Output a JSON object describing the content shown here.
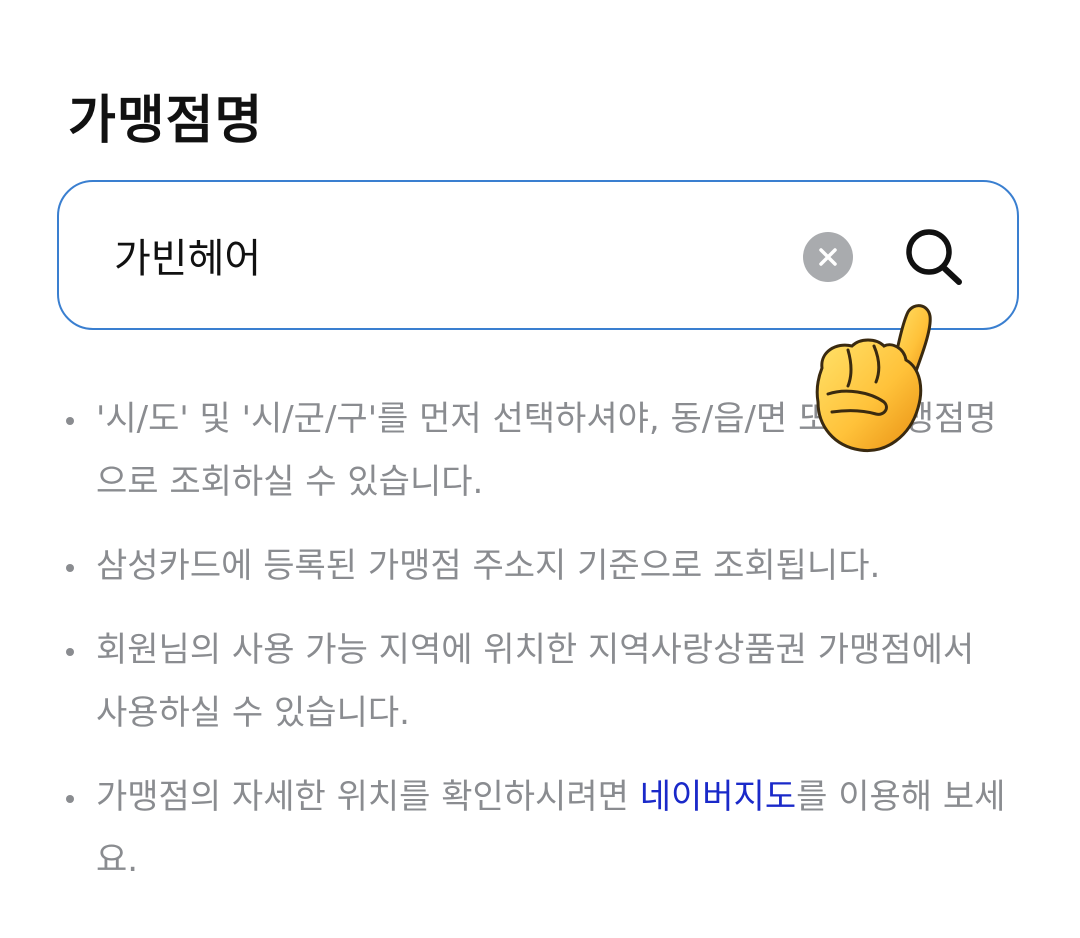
{
  "page": {
    "title": "가맹점명"
  },
  "search": {
    "value": "가빈헤어"
  },
  "icons": {
    "clear": "close-circle-icon",
    "search": "magnifier-icon",
    "pointer": "pointing-hand-emoji"
  },
  "colors": {
    "border": "#3a7fd0",
    "note_text": "#8a8c90",
    "link": "#1a29c9",
    "clear_bg": "#a9abae"
  },
  "notes": {
    "n1": "'시/도' 및 '시/군/구'를 먼저 선택하셔야, 동/읍/면 또는 가맹점명으로 조회하실 수 있습니다.",
    "n2": "삼성카드에 등록된 가맹점 주소지 기준으로 조회됩니다.",
    "n3": "회원님의 사용 가능 지역에 위치한 지역사랑상품권 가맹점에서 사용하실 수 있습니다.",
    "n4_before": "가맹점의 자세한 위치를 확인하시려면 ",
    "n4_link": "네이버지도",
    "n4_after": "를 이용해 보세요."
  }
}
